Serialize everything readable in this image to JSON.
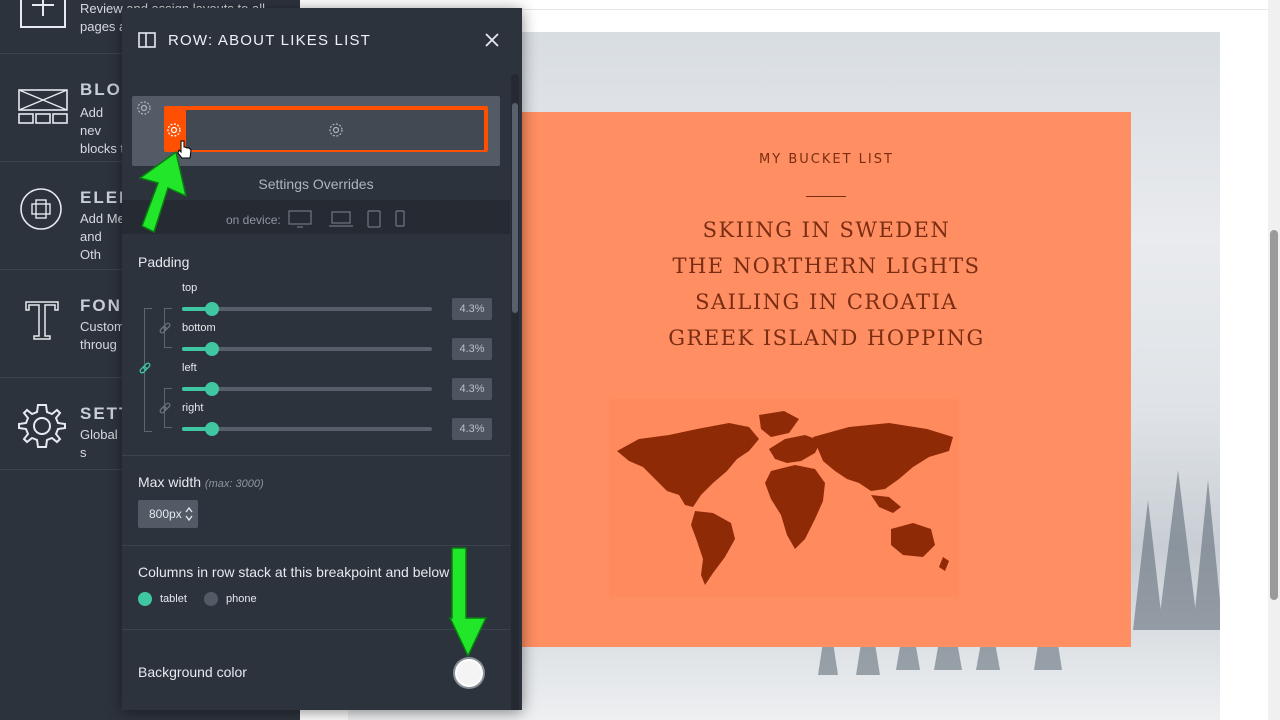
{
  "sidebar": {
    "items": [
      {
        "title": "",
        "desc": "Review and assign layouts to all pages a"
      },
      {
        "title": "BLO",
        "desc": "Add nev blocks t"
      },
      {
        "title": "ELEN",
        "desc": "Add Me and Oth"
      },
      {
        "title": "FON",
        "desc": "Custom throug"
      },
      {
        "title": "SETT",
        "desc": "Global s"
      }
    ]
  },
  "card": {
    "eyebrow": "MY BUCKET LIST",
    "list": [
      "SKIING IN SWEDEN",
      "THE NORTHERN LIGHTS",
      "SAILING IN CROATIA",
      "GREEK ISLAND HOPPING"
    ],
    "bg_color": "#ff8e62",
    "text_color": "#7a2d12"
  },
  "panel": {
    "title": "ROW: ABOUT LIKES LIST",
    "settings_overrides": "Settings Overrides",
    "on_device": "on device:",
    "padding_label": "Padding",
    "padding": [
      {
        "side": "top",
        "value": "4.3%",
        "level": 0.043
      },
      {
        "side": "bottom",
        "value": "4.3%",
        "level": 0.043
      },
      {
        "side": "left",
        "value": "4.3%",
        "level": 0.043
      },
      {
        "side": "right",
        "value": "4.3%",
        "level": 0.043
      }
    ],
    "max_width_label": "Max width",
    "max_width_hint": "(max: 3000)",
    "max_width_value": "800px",
    "columns_label": "Columns in row stack at this breakpoint and below",
    "breakpoints": [
      {
        "label": "tablet",
        "selected": true
      },
      {
        "label": "phone",
        "selected": false
      }
    ],
    "bg_color_label": "Background color",
    "accent_color": "#3ec7a0",
    "highlight_color": "#ff4f00"
  }
}
